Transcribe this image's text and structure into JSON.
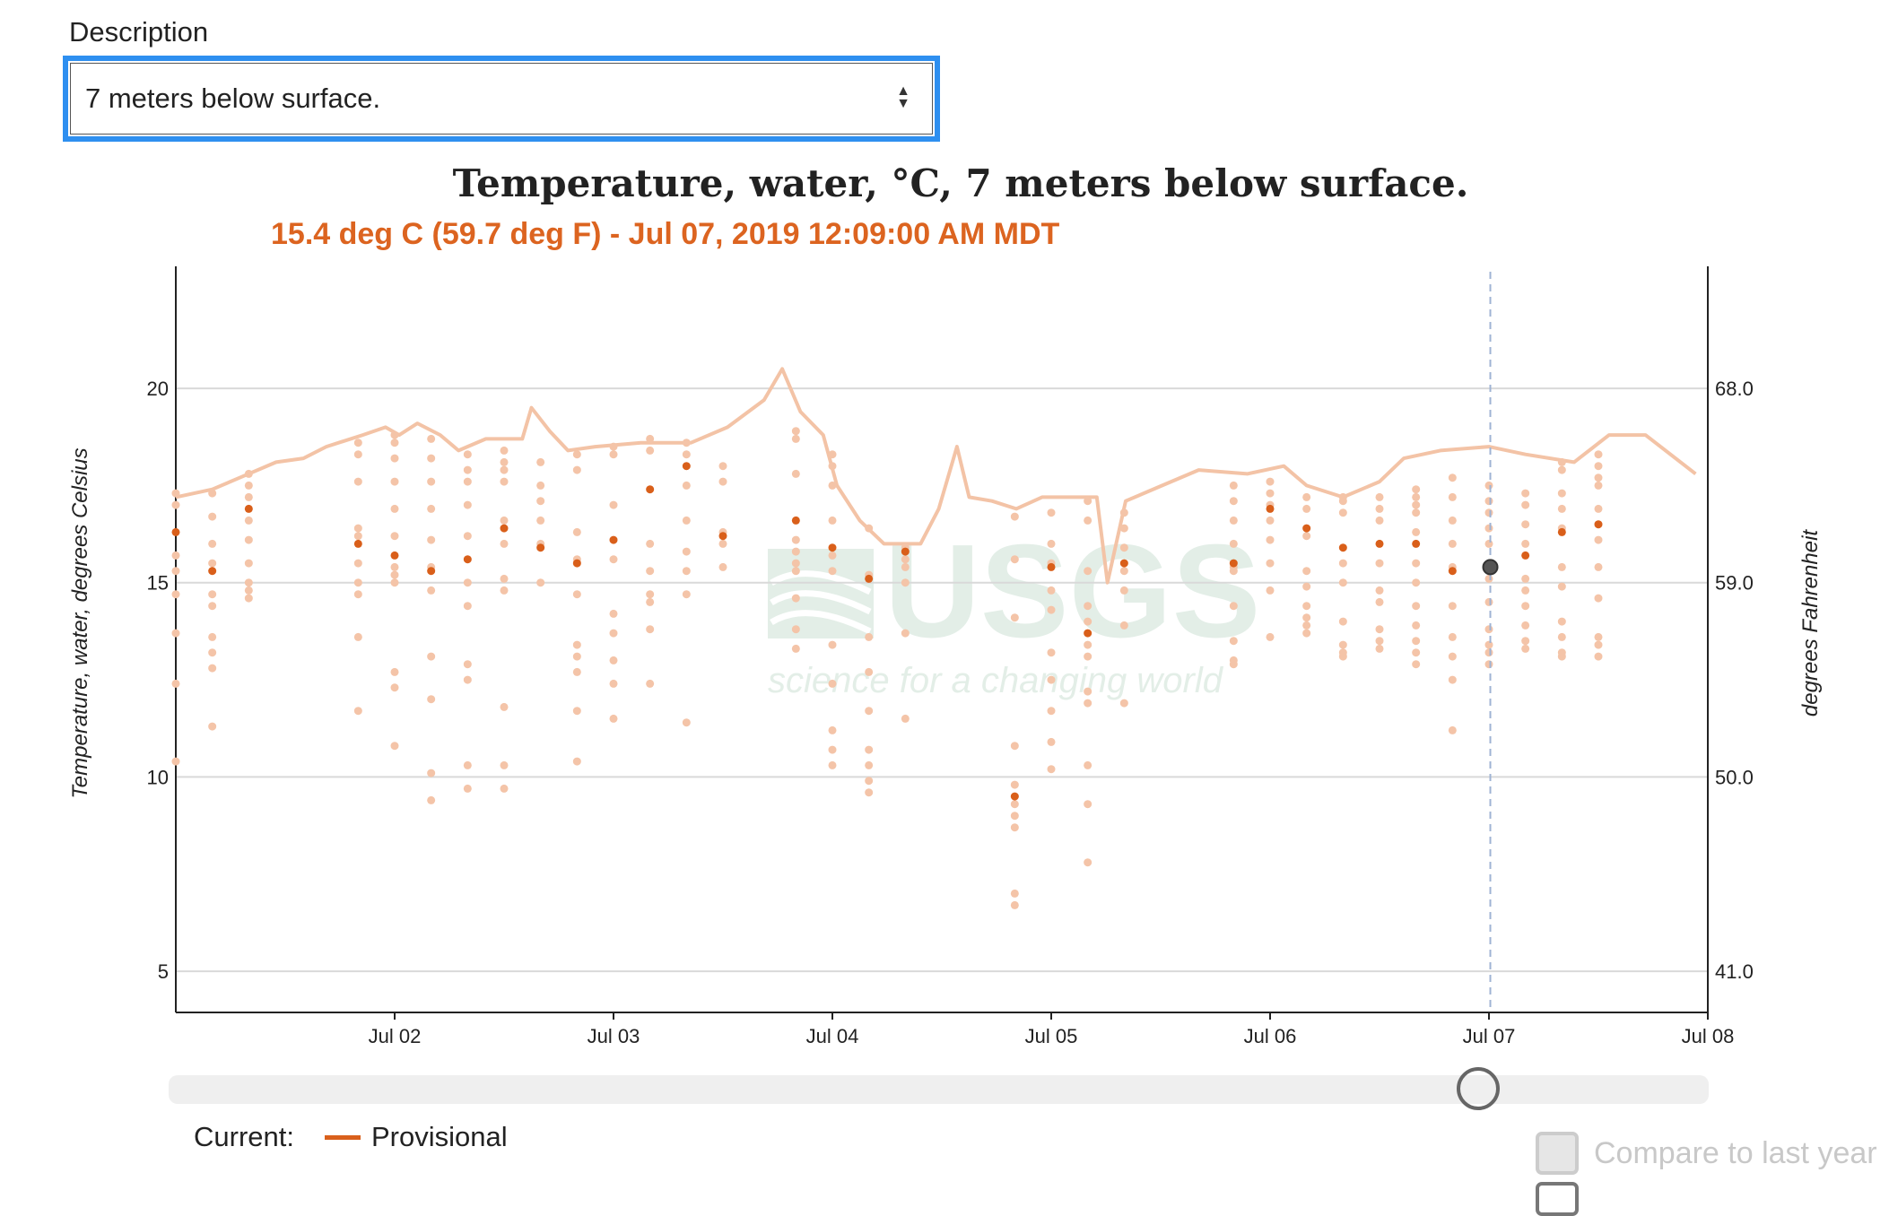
{
  "description": {
    "label": "Description",
    "selected": "7 meters below surface."
  },
  "icons": {
    "select_arrows": "up-down-chevrons-icon"
  },
  "chart_data": {
    "type": "line+scatter",
    "title": "Temperature, water, °C, 7 meters below surface.",
    "tooltip": "15.4 deg C (59.7 deg F) - Jul 07, 2019 12:09:00 AM MDT",
    "ylabel": "Temperature, water, degrees Celsius",
    "ylabel_right": "degrees Fahrenheit",
    "ylim": [
      3.94,
      23.14
    ],
    "xlim": [
      "2019-07-01T00:00",
      "2019-07-08T00:00"
    ],
    "grid": true,
    "yticks": [
      5,
      10,
      15,
      20
    ],
    "yticks_right": [
      "41.0",
      "50.0",
      "59.0",
      "68.0"
    ],
    "xticks": [
      {
        "t": "2019-07-02T00:00",
        "label": "Jul 02"
      },
      {
        "t": "2019-07-03T00:00",
        "label": "Jul 03"
      },
      {
        "t": "2019-07-04T00:00",
        "label": "Jul 04"
      },
      {
        "t": "2019-07-05T00:00",
        "label": "Jul 05"
      },
      {
        "t": "2019-07-06T00:00",
        "label": "Jul 06"
      },
      {
        "t": "2019-07-07T00:00",
        "label": "Jul 07"
      },
      {
        "t": "2019-07-08T00:00",
        "label": "Jul 08"
      }
    ],
    "cursor_time": "2019-07-07T00:09",
    "cursor_value": 15.4,
    "colors": {
      "line": "#f3c3a6",
      "dot_light": "#f4c4a8",
      "dot_dark": "#d95f1a",
      "grid": "#d9d9d9",
      "cursor": "#9fb3d4",
      "watermark": "#e3eee7"
    },
    "line": [
      [
        "2019-07-01T00:00",
        17.2
      ],
      [
        "2019-07-01T04:00",
        17.4
      ],
      [
        "2019-07-01T07:00",
        17.7
      ],
      [
        "2019-07-01T11:00",
        18.1
      ],
      [
        "2019-07-01T14:00",
        18.2
      ],
      [
        "2019-07-01T16:30",
        18.5
      ],
      [
        "2019-07-01T20:30",
        18.8
      ],
      [
        "2019-07-01T23:00",
        19.0
      ],
      [
        "2019-07-02T00:30",
        18.8
      ],
      [
        "2019-07-02T02:30",
        19.1
      ],
      [
        "2019-07-02T05:00",
        18.8
      ],
      [
        "2019-07-02T07:00",
        18.4
      ],
      [
        "2019-07-02T10:00",
        18.7
      ],
      [
        "2019-07-02T14:00",
        18.7
      ],
      [
        "2019-07-02T15:00",
        19.5
      ],
      [
        "2019-07-02T17:00",
        18.9
      ],
      [
        "2019-07-02T19:00",
        18.4
      ],
      [
        "2019-07-02T22:00",
        18.5
      ],
      [
        "2019-07-03T03:00",
        18.6
      ],
      [
        "2019-07-03T08:30",
        18.6
      ],
      [
        "2019-07-03T12:30",
        19.0
      ],
      [
        "2019-07-03T16:30",
        19.7
      ],
      [
        "2019-07-03T18:30",
        20.5
      ],
      [
        "2019-07-03T20:30",
        19.4
      ],
      [
        "2019-07-03T23:00",
        18.8
      ],
      [
        "2019-07-04T00:30",
        17.5
      ],
      [
        "2019-07-04T03:00",
        16.6
      ],
      [
        "2019-07-04T05:40",
        16.0
      ],
      [
        "2019-07-04T09:40",
        16.0
      ],
      [
        "2019-07-04T11:40",
        16.9
      ],
      [
        "2019-07-04T13:40",
        18.5
      ],
      [
        "2019-07-04T15:00",
        17.2
      ],
      [
        "2019-07-04T17:30",
        17.1
      ],
      [
        "2019-07-04T20:10",
        16.9
      ],
      [
        "2019-07-04T23:00",
        17.2
      ],
      [
        "2019-07-05T01:30",
        17.2
      ],
      [
        "2019-07-05T05:00",
        17.2
      ],
      [
        "2019-07-05T06:10",
        15.0
      ],
      [
        "2019-07-05T08:10",
        17.1
      ],
      [
        "2019-07-05T12:10",
        17.5
      ],
      [
        "2019-07-05T16:10",
        17.9
      ],
      [
        "2019-07-05T21:30",
        17.8
      ],
      [
        "2019-07-06T01:30",
        18.0
      ],
      [
        "2019-07-06T04:00",
        17.5
      ],
      [
        "2019-07-06T08:00",
        17.2
      ],
      [
        "2019-07-06T12:00",
        17.6
      ],
      [
        "2019-07-06T14:40",
        18.2
      ],
      [
        "2019-07-06T18:40",
        18.4
      ],
      [
        "2019-07-07T00:00",
        18.5
      ],
      [
        "2019-07-07T04:00",
        18.3
      ],
      [
        "2019-07-07T09:20",
        18.1
      ],
      [
        "2019-07-07T13:10",
        18.8
      ],
      [
        "2019-07-07T17:10",
        18.8
      ],
      [
        "2019-07-07T22:40",
        17.8
      ]
    ],
    "scatter": [
      {
        "t": "2019-07-01T00:00",
        "dark": 16.3,
        "values": [
          17.3,
          17.0,
          15.7,
          15.3,
          14.7,
          13.7,
          12.4,
          10.4
        ]
      },
      {
        "t": "2019-07-01T04:00",
        "dark": 15.3,
        "values": [
          17.3,
          16.7,
          16.0,
          15.5,
          14.7,
          14.4,
          13.6,
          13.2,
          12.8,
          11.3
        ]
      },
      {
        "t": "2019-07-01T08:00",
        "dark": 16.9,
        "values": [
          17.8,
          17.5,
          17.2,
          16.6,
          16.1,
          15.5,
          15.0,
          14.8,
          14.6
        ]
      },
      {
        "t": "2019-07-01T20:00",
        "dark": 16.0,
        "values": [
          18.6,
          18.3,
          17.6,
          16.4,
          16.2,
          15.5,
          15.0,
          14.7,
          13.6,
          11.7
        ]
      },
      {
        "t": "2019-07-02T00:00",
        "dark": 15.7,
        "values": [
          18.8,
          18.6,
          18.2,
          17.6,
          16.9,
          16.2,
          15.4,
          15.2,
          15.0,
          12.7,
          12.3,
          10.8
        ]
      },
      {
        "t": "2019-07-02T04:00",
        "dark": 15.3,
        "values": [
          18.7,
          18.2,
          17.6,
          16.9,
          16.1,
          15.4,
          14.8,
          13.1,
          12.0,
          10.1,
          9.4
        ]
      },
      {
        "t": "2019-07-02T08:00",
        "dark": 15.6,
        "values": [
          18.3,
          17.9,
          17.6,
          17.0,
          16.2,
          15.0,
          14.4,
          12.9,
          12.5,
          10.3,
          9.7
        ]
      },
      {
        "t": "2019-07-02T12:00",
        "dark": 16.4,
        "values": [
          18.4,
          18.1,
          17.9,
          17.6,
          16.6,
          16.0,
          15.1,
          14.8,
          11.8,
          10.3,
          9.7
        ]
      },
      {
        "t": "2019-07-02T16:00",
        "dark": 15.9,
        "values": [
          18.1,
          17.5,
          17.1,
          16.6,
          16.0,
          15.0
        ]
      },
      {
        "t": "2019-07-02T20:00",
        "dark": 15.5,
        "values": [
          18.3,
          17.9,
          16.3,
          15.6,
          14.7,
          13.4,
          13.1,
          12.7,
          11.7,
          10.4
        ]
      },
      {
        "t": "2019-07-03T00:00",
        "dark": 16.1,
        "values": [
          18.5,
          18.3,
          17.0,
          15.6,
          14.2,
          13.7,
          13.0,
          12.4,
          11.5
        ]
      },
      {
        "t": "2019-07-03T04:00",
        "dark": 17.4,
        "values": [
          18.7,
          18.4,
          16.0,
          15.3,
          14.7,
          14.5,
          13.8,
          12.4
        ]
      },
      {
        "t": "2019-07-03T08:00",
        "dark": 18.0,
        "values": [
          18.6,
          18.3,
          17.5,
          16.6,
          15.8,
          15.3,
          14.7,
          11.4
        ]
      },
      {
        "t": "2019-07-03T12:00",
        "dark": 16.2,
        "values": [
          18.0,
          17.6,
          16.3,
          16.0,
          15.4
        ]
      },
      {
        "t": "2019-07-03T20:00",
        "dark": 16.6,
        "values": [
          18.9,
          18.7,
          17.8,
          16.1,
          15.8,
          15.5,
          15.3,
          14.6,
          13.8,
          13.3
        ]
      },
      {
        "t": "2019-07-04T00:00",
        "dark": 15.9,
        "values": [
          18.3,
          18.0,
          17.5,
          16.6,
          15.7,
          15.3,
          13.4,
          12.4,
          11.2,
          10.7,
          10.3
        ]
      },
      {
        "t": "2019-07-04T04:00",
        "dark": 15.1,
        "values": [
          16.4,
          15.2,
          13.6,
          12.7,
          11.7,
          10.7,
          10.3,
          9.9,
          9.6
        ]
      },
      {
        "t": "2019-07-04T08:00",
        "dark": 15.8,
        "values": [
          15.9,
          15.6,
          15.4,
          15.0,
          13.7,
          11.5
        ]
      },
      {
        "t": "2019-07-04T20:00",
        "dark": 9.5,
        "values": [
          16.7,
          15.6,
          14.1,
          10.8,
          9.8,
          9.3,
          9.0,
          8.7,
          7.0,
          6.7
        ]
      },
      {
        "t": "2019-07-05T00:00",
        "dark": 15.4,
        "values": [
          16.8,
          16.0,
          15.5,
          14.8,
          14.3,
          13.2,
          12.5,
          11.7,
          10.9,
          10.2
        ]
      },
      {
        "t": "2019-07-05T04:00",
        "dark": 13.7,
        "values": [
          17.1,
          16.6,
          15.3,
          14.4,
          14.0,
          13.4,
          13.1,
          12.2,
          11.9,
          10.3,
          9.3,
          7.8
        ]
      },
      {
        "t": "2019-07-05T08:00",
        "dark": 15.5,
        "values": [
          16.8,
          16.4,
          15.9,
          15.3,
          14.8,
          13.9,
          11.9
        ]
      },
      {
        "t": "2019-07-05T20:00",
        "dark": 15.5,
        "values": [
          17.5,
          17.1,
          16.6,
          16.0,
          15.4,
          15.3,
          14.4,
          13.5,
          13.0,
          12.9
        ]
      },
      {
        "t": "2019-07-06T00:00",
        "dark": 16.9,
        "values": [
          17.6,
          17.3,
          17.0,
          16.6,
          16.1,
          15.5,
          14.8,
          13.6
        ]
      },
      {
        "t": "2019-07-06T04:00",
        "dark": 16.4,
        "values": [
          17.2,
          16.9,
          16.2,
          15.3,
          14.9,
          14.4,
          14.1,
          13.9,
          13.7
        ]
      },
      {
        "t": "2019-07-06T08:00",
        "dark": 15.9,
        "values": [
          17.2,
          17.1,
          16.8,
          15.5,
          15.0,
          14.0,
          13.4,
          13.2,
          13.1
        ]
      },
      {
        "t": "2019-07-06T12:00",
        "dark": 16.0,
        "values": [
          17.2,
          16.9,
          16.6,
          15.5,
          14.8,
          14.5,
          13.8,
          13.5,
          13.3
        ]
      },
      {
        "t": "2019-07-06T16:00",
        "dark": 16.0,
        "values": [
          17.4,
          17.2,
          17.0,
          16.8,
          16.3,
          15.5,
          15.0,
          14.4,
          13.9,
          13.5,
          13.2,
          12.9
        ]
      },
      {
        "t": "2019-07-06T20:00",
        "dark": 15.3,
        "values": [
          17.7,
          17.2,
          16.6,
          16.0,
          15.4,
          14.4,
          13.6,
          13.1,
          12.5,
          11.2
        ]
      },
      {
        "t": "2019-07-07T00:00",
        "dark": 15.4,
        "values": [
          17.5,
          17.1,
          16.8,
          16.4,
          16.0,
          15.1,
          14.5,
          13.8,
          13.4,
          13.2,
          12.9
        ]
      },
      {
        "t": "2019-07-07T04:00",
        "dark": 15.7,
        "values": [
          17.3,
          17.0,
          16.5,
          16.0,
          15.1,
          14.8,
          14.4,
          13.9,
          13.5,
          13.3
        ]
      },
      {
        "t": "2019-07-07T08:00",
        "dark": 16.3,
        "values": [
          18.1,
          17.9,
          17.3,
          16.9,
          16.4,
          15.4,
          14.9,
          14.0,
          13.6,
          13.2,
          13.1
        ]
      },
      {
        "t": "2019-07-07T12:00",
        "dark": 16.5,
        "values": [
          18.3,
          18.0,
          17.7,
          17.5,
          16.9,
          16.5,
          16.1,
          15.4,
          14.6,
          13.6,
          13.4,
          13.1
        ]
      }
    ],
    "watermark": {
      "logo": "USGS",
      "tagline": "science for a changing world"
    }
  },
  "slider": {
    "position_time": "2019-07-07T00:00"
  },
  "legend": {
    "current_label": "Current:",
    "series_label": "Provisional",
    "series_color": "#d9601c"
  },
  "compare": {
    "label": "Compare to last year",
    "checked": false
  }
}
